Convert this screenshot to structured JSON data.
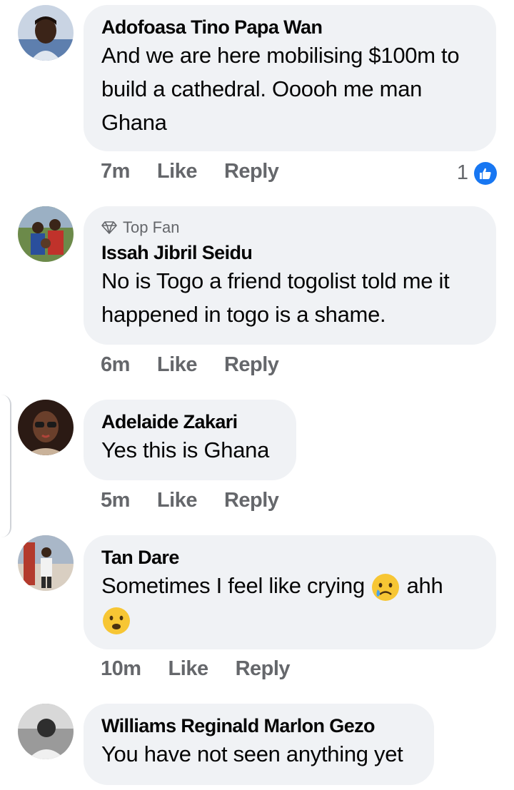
{
  "comments": [
    {
      "author": "Adofoasa Tino Papa Wan",
      "text": "And we are here mobilising $100m to build a cathedral.  Ooooh me man Ghana",
      "time": "7m",
      "like": "Like",
      "reply": "Reply",
      "reaction_count": "1"
    },
    {
      "badge": "Top Fan",
      "author": "Issah Jibril Seidu",
      "text": "No is Togo a friend togolist told me it happened in togo is a shame.",
      "time": "6m",
      "like": "Like",
      "reply": "Reply"
    },
    {
      "author": "Adelaide Zakari",
      "text": "Yes this is Ghana",
      "time": "5m",
      "like": "Like",
      "reply": "Reply"
    },
    {
      "author": "Tan Dare",
      "text_before": "Sometimes I feel like crying",
      "text_after": "ahh",
      "time": "10m",
      "like": "Like",
      "reply": "Reply"
    },
    {
      "author": "Williams Reginald Marlon Gezo",
      "text": "You have not seen anything yet"
    }
  ],
  "colors": {
    "bubble": "#f0f2f5",
    "secondary_text": "#65676b",
    "like_blue": "#1877f2"
  },
  "icons": [
    "diamond-icon",
    "like-thumb-icon",
    "crying-emoji-icon",
    "frowning-emoji-icon"
  ]
}
